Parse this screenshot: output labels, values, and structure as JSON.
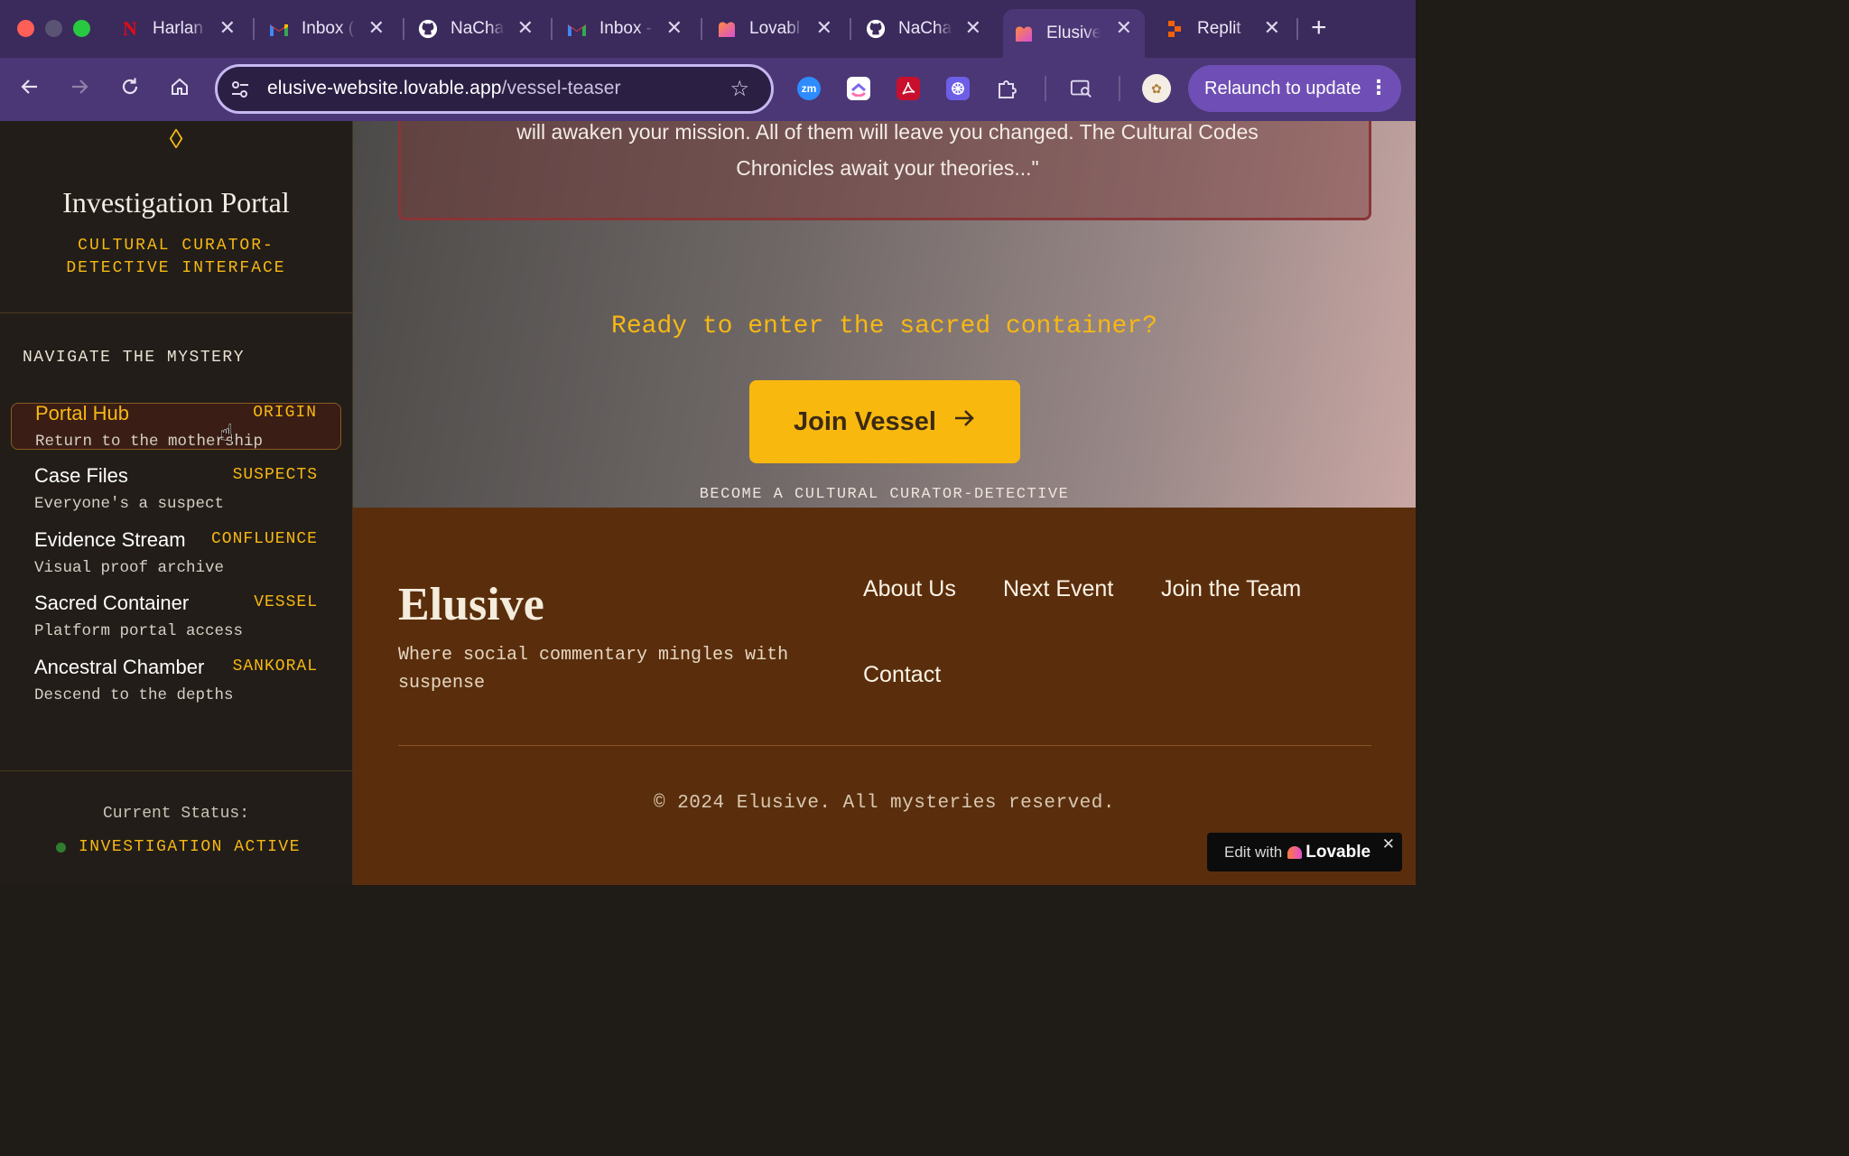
{
  "browser": {
    "tabs": [
      {
        "title": "Harlan",
        "icon": "netflix-icon"
      },
      {
        "title": "Inbox (",
        "icon": "gmail-icon"
      },
      {
        "title": "NaCha",
        "icon": "github-icon"
      },
      {
        "title": "Inbox -",
        "icon": "gmail-icon"
      },
      {
        "title": "Lovabl",
        "icon": "lovable-icon"
      },
      {
        "title": "NaCha",
        "icon": "github-icon"
      },
      {
        "title": "Elusive",
        "icon": "lovable-icon",
        "active": true
      },
      {
        "title": "Replit",
        "icon": "replit-icon"
      }
    ],
    "url_host": "elusive-website.lovable.app",
    "url_path": "/vessel-teaser",
    "relaunch_label": "Relaunch to update",
    "extensions": [
      "zoom-extension-icon",
      "clickup-extension-icon",
      "acrobat-extension-icon",
      "perplexity-extension-icon",
      "extensions-puzzle-icon"
    ]
  },
  "sidebar": {
    "title": "Investigation Portal",
    "subtitle_line1": "CULTURAL CURATOR-",
    "subtitle_line2": "DETECTIVE INTERFACE",
    "nav_heading": "NAVIGATE THE MYSTERY",
    "items": [
      {
        "name": "Portal Hub",
        "tag": "ORIGIN",
        "desc": "Return to the mothership",
        "active": true
      },
      {
        "name": "Case Files",
        "tag": "SUSPECTS",
        "desc": "Everyone's a suspect"
      },
      {
        "name": "Evidence Stream",
        "tag": "CONFLUENCE",
        "desc": "Visual proof archive"
      },
      {
        "name": "Sacred Container",
        "tag": "VESSEL",
        "desc": "Platform portal access"
      },
      {
        "name": "Ancestral Chamber",
        "tag": "SANKORAL",
        "desc": "Descend to the depths"
      }
    ],
    "status_label": "Current Status:",
    "status_value": "INVESTIGATION ACTIVE",
    "accent_color": "#f7b814"
  },
  "hero": {
    "quote_line1": "will awaken your mission. All of them will leave you changed. The Cultural Codes",
    "quote_line2": "Chronicles await your theories...\"",
    "cta_question": "Ready to enter the sacred container?",
    "join_button": "Join Vessel",
    "become_caption": "BECOME A CULTURAL CURATOR-DETECTIVE"
  },
  "footer": {
    "brand": "Elusive",
    "tagline": "Where social commentary mingles with suspense",
    "links": [
      "About Us",
      "Next Event",
      "Join the Team",
      "Contact"
    ],
    "copyright": "© 2024 Elusive. All mysteries reserved.",
    "edit_badge_prefix": "Edit with",
    "edit_badge_brand": "Lovable",
    "background_color": "#5a2e0c"
  }
}
